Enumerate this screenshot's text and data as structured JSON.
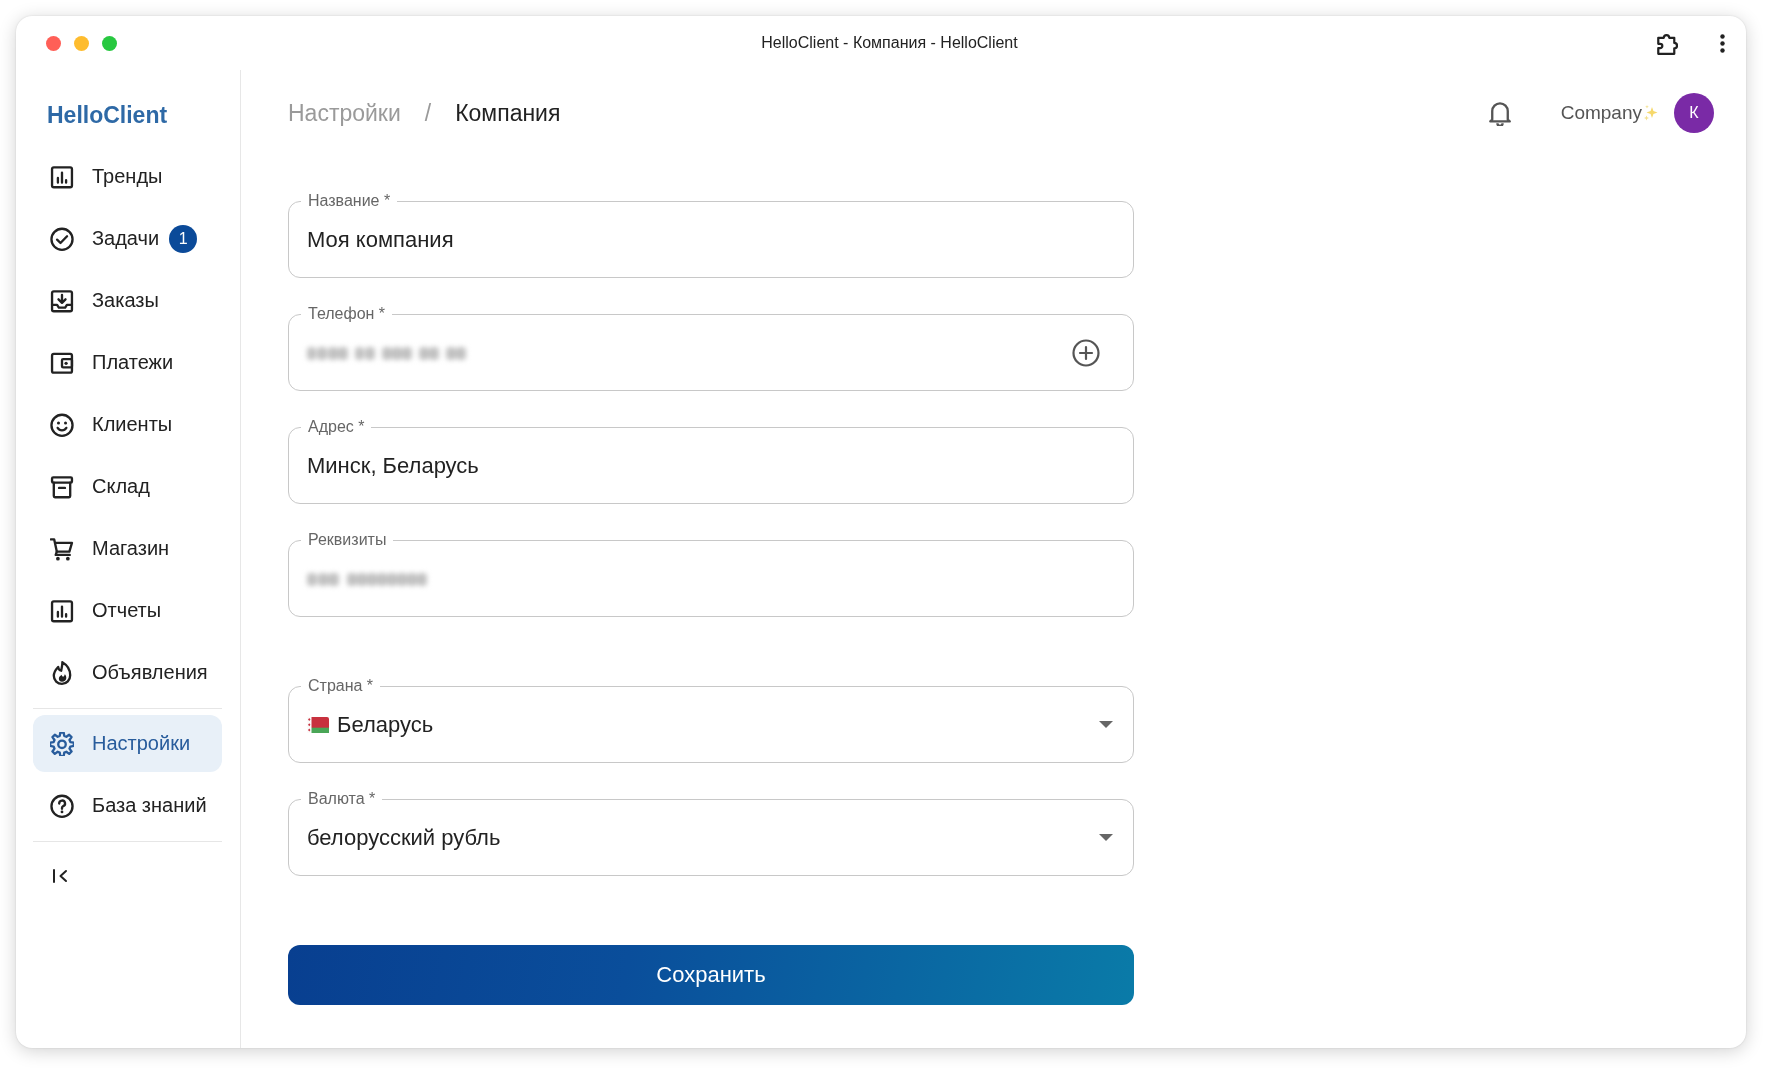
{
  "window": {
    "title": "HelloClient - Компания - HelloClient"
  },
  "sidebar": {
    "logo": "HelloClient",
    "groups": [
      {
        "items": [
          {
            "label": "Тренды",
            "selected": false
          },
          {
            "label": "Задачи",
            "badge": "1",
            "selected": false
          },
          {
            "label": "Заказы",
            "selected": false
          },
          {
            "label": "Платежи",
            "selected": false
          },
          {
            "label": "Клиенты",
            "selected": false
          },
          {
            "label": "Склад",
            "selected": false
          },
          {
            "label": "Магазин",
            "selected": false
          },
          {
            "label": "Отчеты",
            "selected": false
          },
          {
            "label": "Объявления",
            "selected": false
          }
        ]
      },
      {
        "items": [
          {
            "label": "Настройки",
            "selected": true
          },
          {
            "label": "База знаний",
            "selected": false
          }
        ]
      }
    ]
  },
  "header": {
    "breadcrumbs": [
      {
        "label": "Настройки",
        "current": false
      },
      {
        "label": "Компания",
        "current": true
      }
    ],
    "separator": "/",
    "account": {
      "name": "Company",
      "avatar_letter": "К"
    }
  },
  "form": {
    "sections": [
      {
        "fields": [
          {
            "kind": "text",
            "label": "Название *",
            "value": "Моя компания",
            "redacted": false
          },
          {
            "kind": "phone",
            "label": "Телефон *",
            "redacted": true
          },
          {
            "kind": "text",
            "label": "Адрес *",
            "value": "Минск, Беларусь",
            "redacted": false
          },
          {
            "kind": "text",
            "label": "Реквизиты",
            "redacted": true
          }
        ]
      },
      {
        "fields": [
          {
            "kind": "select",
            "label": "Страна *",
            "value": "Беларусь",
            "redacted": false,
            "flag": true
          },
          {
            "kind": "select",
            "label": "Валюта *",
            "value": "белорусский рубль",
            "redacted": false,
            "flag": false
          }
        ]
      }
    ],
    "submit": {
      "label": "Сохранить"
    }
  }
}
